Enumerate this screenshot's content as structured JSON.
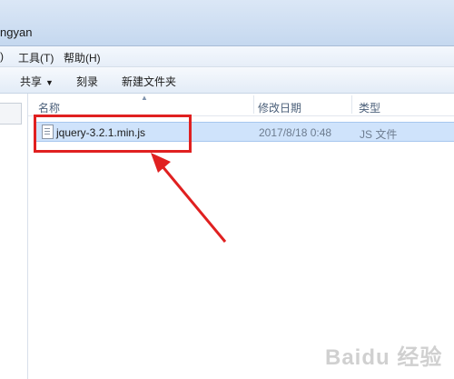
{
  "window": {
    "title_fragment": "ngyan"
  },
  "menu": [
    {
      "label": ")"
    },
    {
      "label": "工具(T)"
    },
    {
      "label": "帮助(H)"
    }
  ],
  "toolbar": {
    "share_label": "共享",
    "burn_label": "刻录",
    "new_folder_label": "新建文件夹"
  },
  "columns": {
    "name": "名称",
    "date": "修改日期",
    "type": "类型"
  },
  "files": [
    {
      "name": "jquery-3.2.1.min.js",
      "date": "2017/8/18 0:48",
      "type": "JS 文件"
    }
  ],
  "annotation": {
    "color": "#e02020"
  },
  "watermark": {
    "text": "Baidu 经验"
  }
}
